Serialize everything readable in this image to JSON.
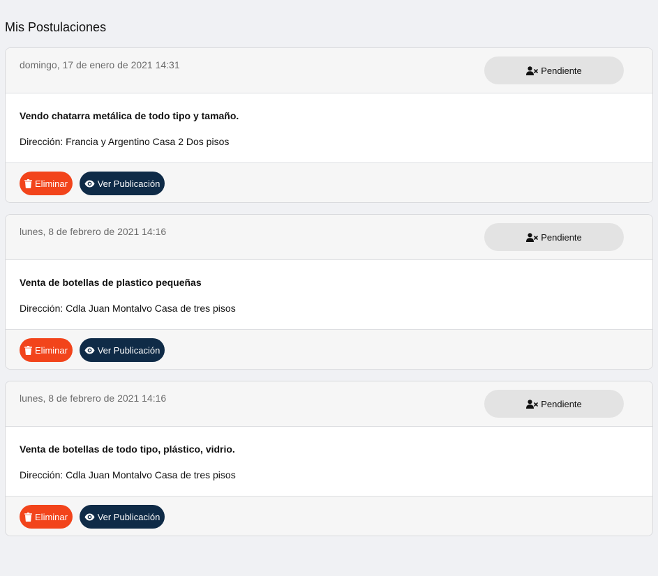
{
  "page": {
    "title": "Mis Postulaciones"
  },
  "colors": {
    "background": "#f0f1f4",
    "delete_button": "#f2441b",
    "view_button": "#0f2b47",
    "status_pill": "#e3e3e3"
  },
  "postulaciones": [
    {
      "date": "domingo, 17 de enero de 2021 14:31",
      "status": "Pendiente",
      "status_icon": "user-x-icon",
      "title": "Vendo chatarra metálica de todo tipo y tamaño.",
      "address": "Dirección: Francia y Argentino Casa 2 Dos pisos",
      "delete_label": "Eliminar",
      "delete_icon": "trash-icon",
      "view_label": "Ver Publicación",
      "view_icon": "eye-icon"
    },
    {
      "date": "lunes, 8 de febrero de 2021 14:16",
      "status": "Pendiente",
      "status_icon": "user-x-icon",
      "title": "Venta de botellas de plastico pequeñas",
      "address": "Dirección: Cdla Juan Montalvo Casa de tres pisos",
      "delete_label": "Eliminar",
      "delete_icon": "trash-icon",
      "view_label": "Ver Publicación",
      "view_icon": "eye-icon"
    },
    {
      "date": "lunes, 8 de febrero de 2021 14:16",
      "status": "Pendiente",
      "status_icon": "user-x-icon",
      "title": "Venta de botellas de todo tipo, plástico, vidrio.",
      "address": "Dirección: Cdla Juan Montalvo Casa de tres pisos",
      "delete_label": "Eliminar",
      "delete_icon": "trash-icon",
      "view_label": "Ver Publicación",
      "view_icon": "eye-icon"
    }
  ]
}
